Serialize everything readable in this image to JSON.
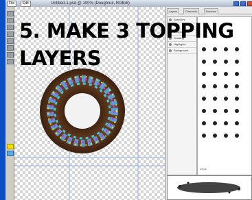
{
  "window": {
    "title": "Untitled-1.psd @ 100% (Doughnut, RGB/8)",
    "menu_buttons": [
      "File",
      "Edit"
    ]
  },
  "heading": {
    "line1": "5. MAKE 3 TOPPING",
    "line2": "LAYERS"
  },
  "panels": {
    "tabs": [
      "Layers",
      "Channels",
      "Brushes"
    ],
    "layers": [
      "Sprinkles",
      "Icing",
      "Doughnut",
      "Shading",
      "Highlights",
      "Background"
    ],
    "brush_size": "13 px"
  },
  "colors": {
    "accent": "#0a4fc4",
    "donut": "#6b3f22",
    "icing": "#5aa9e6"
  },
  "icons": {
    "toolbox": [
      "move-tool-icon",
      "marquee-tool-icon",
      "lasso-tool-icon",
      "crop-tool-icon",
      "brush-tool-icon",
      "eraser-tool-icon",
      "text-tool-icon",
      "zoom-tool-icon"
    ]
  }
}
